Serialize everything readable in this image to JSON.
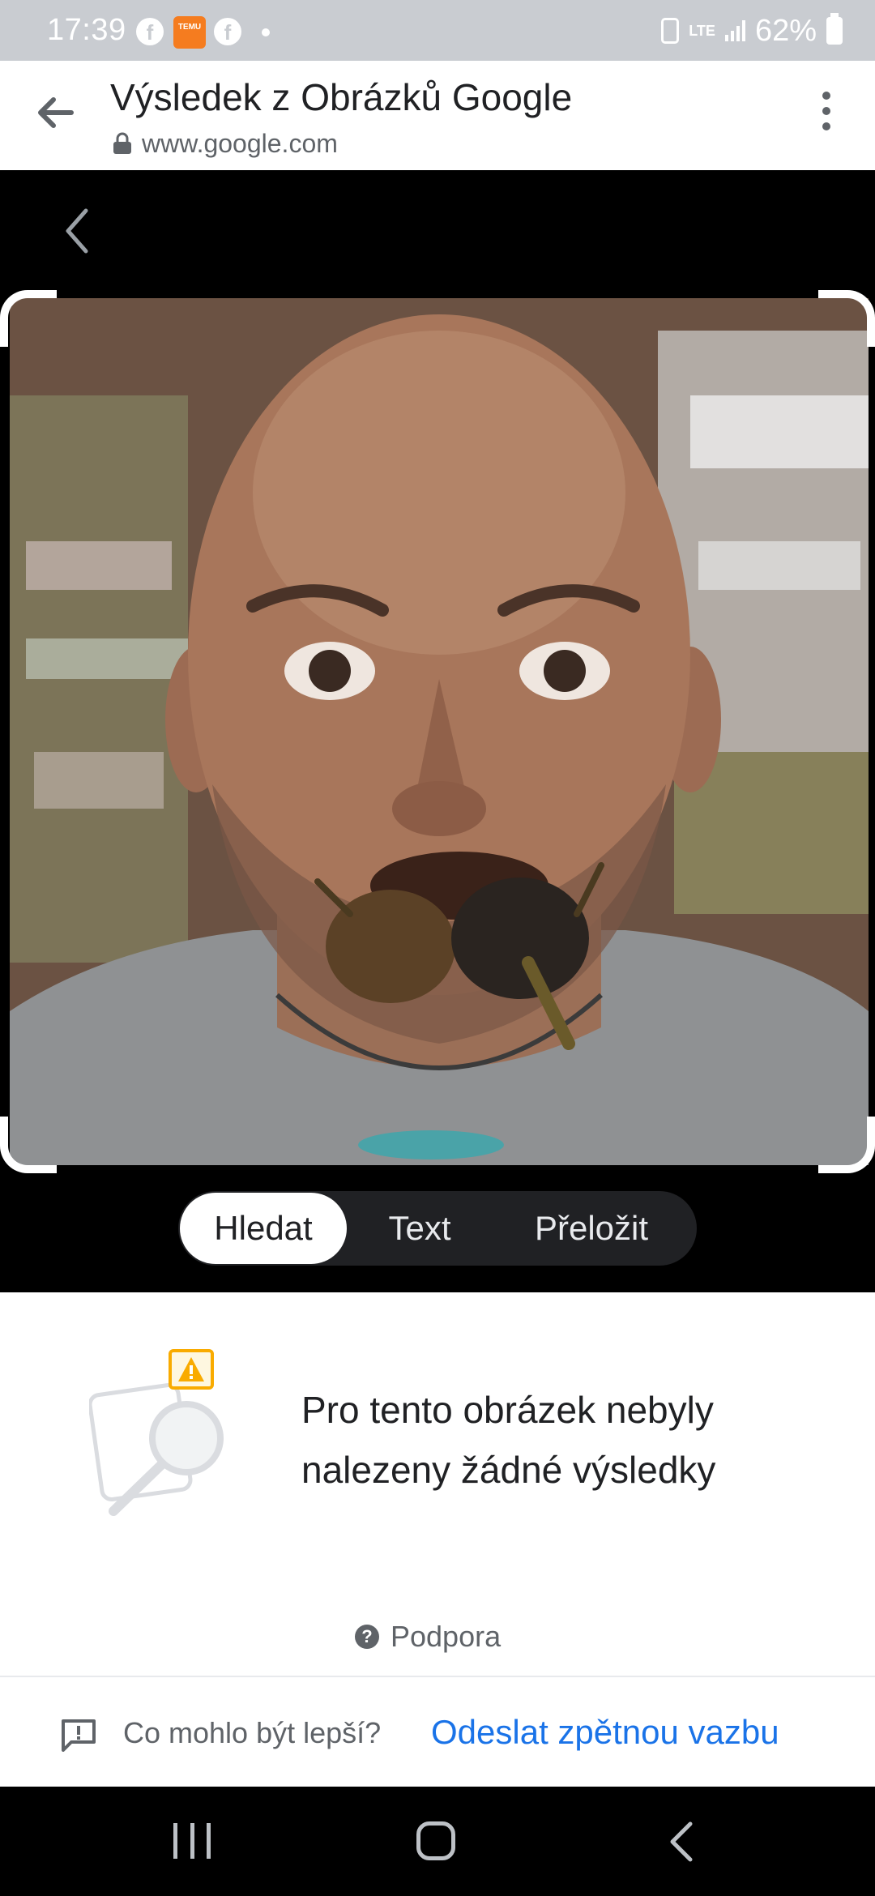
{
  "status_bar": {
    "time": "17:39",
    "temu_label": "TEMU",
    "network": "LTE",
    "battery": "62%"
  },
  "app_bar": {
    "title": "Výsledek z Obrázků Google",
    "url": "www.google.com"
  },
  "lens": {
    "tabs": [
      {
        "label": "Hledat",
        "active": true
      },
      {
        "label": "Text",
        "active": false
      },
      {
        "label": "Přeložit",
        "active": false
      }
    ]
  },
  "results": {
    "no_results_message": "Pro tento obrázek nebyly nalezeny žádné výsledky",
    "support_label": "Podpora"
  },
  "feedback": {
    "question": "Co mohlo být lepší?",
    "link_label": "Odeslat zpětnou vazbu"
  },
  "colors": {
    "accent": "#1a73e8",
    "status_bar_bg": "#c9ccd1",
    "warning": "#f9ab00"
  },
  "icons": {
    "status": [
      "facebook-icon",
      "temu-icon",
      "facebook-icon",
      "battery-saver-icon",
      "signal-icon",
      "battery-icon"
    ],
    "app_bar": [
      "back-arrow-icon",
      "lock-icon",
      "more-vert-icon"
    ],
    "nav": [
      "recents-icon",
      "home-icon",
      "back-icon"
    ]
  }
}
